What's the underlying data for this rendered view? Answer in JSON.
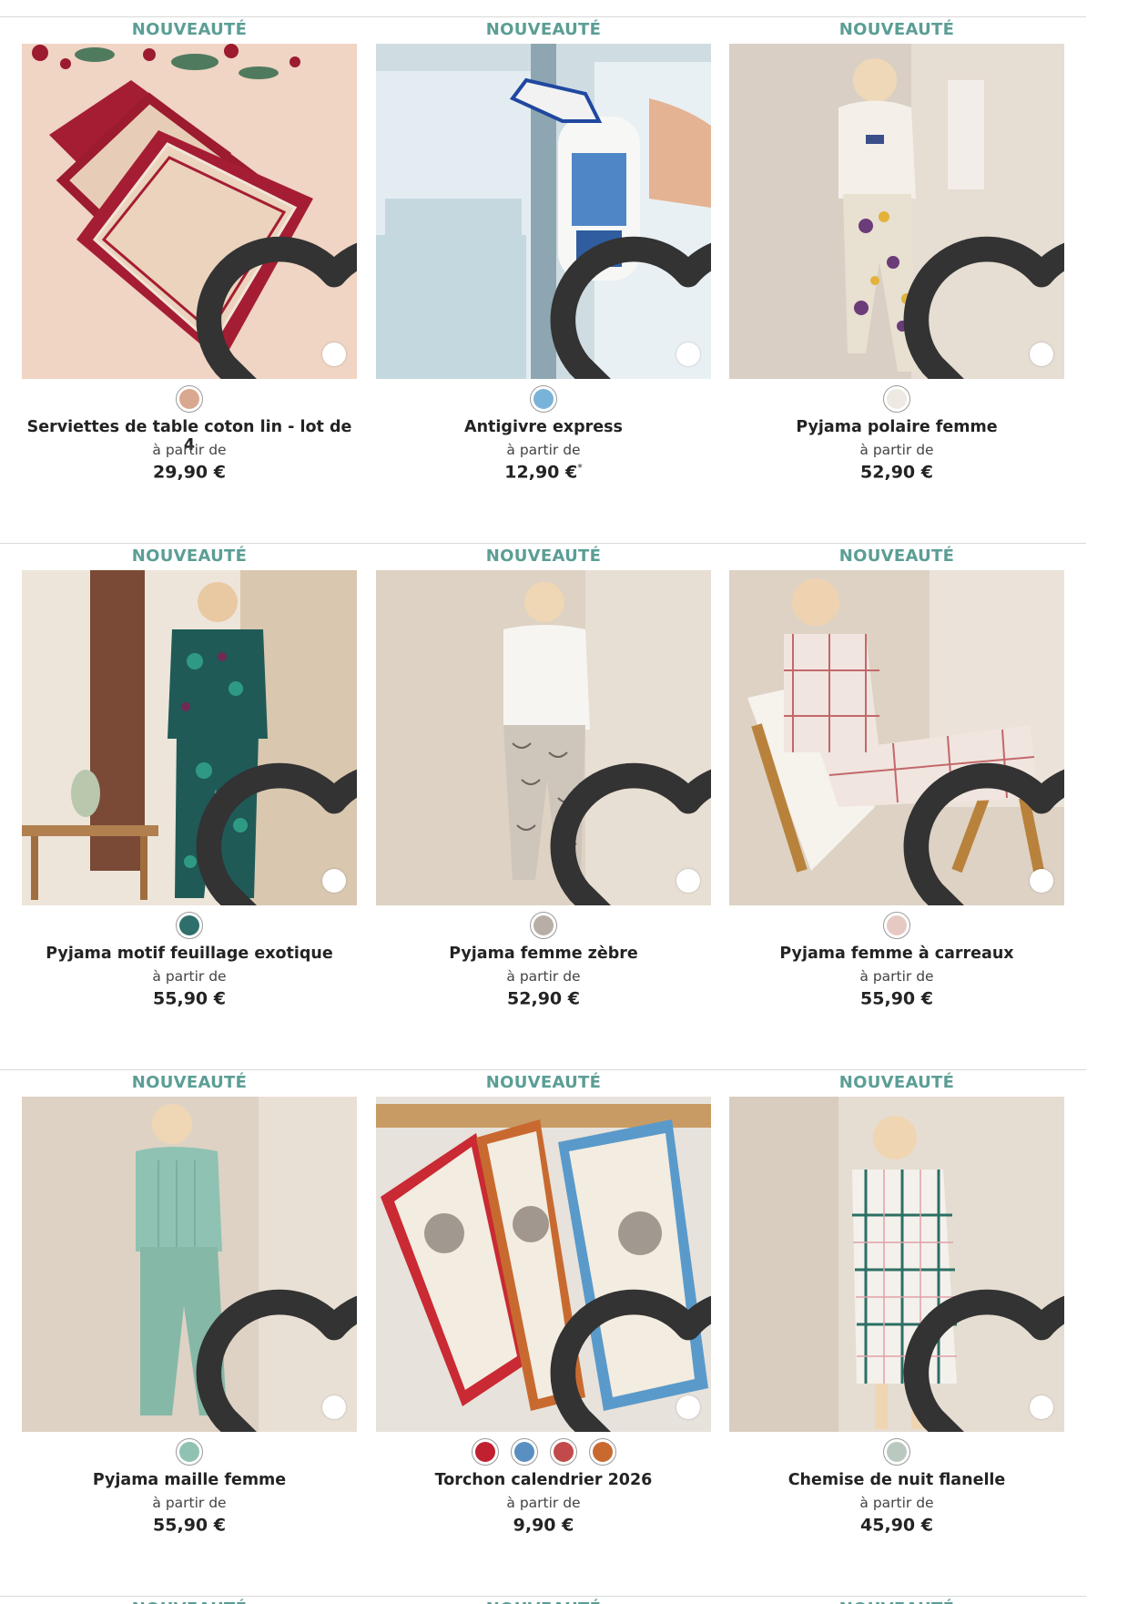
{
  "badge_label": "NOUVEAUTÉ",
  "from_label": "à partir de",
  "products": [
    {
      "title": "Serviettes de table coton lin - lot de 4",
      "price": "29,90 €",
      "price_mark": "",
      "swatches": [
        "#d9a88e"
      ],
      "image": "napkins"
    },
    {
      "title": "Antigivre express",
      "price": "12,90 €",
      "price_mark": "*",
      "swatches": [
        "#7ab3d9"
      ],
      "image": "spray"
    },
    {
      "title": "Pyjama polaire femme",
      "price": "52,90 €",
      "price_mark": "",
      "swatches": [
        "#efe9e3"
      ],
      "image": "pyjama-fleece"
    },
    {
      "title": "Pyjama motif feuillage exotique",
      "price": "55,90 €",
      "price_mark": "",
      "swatches": [
        "#2f6f6b"
      ],
      "image": "pyjama-leaf"
    },
    {
      "title": "Pyjama femme zèbre",
      "price": "52,90 €",
      "price_mark": "",
      "swatches": [
        "#b7aea6"
      ],
      "image": "pyjama-zebra"
    },
    {
      "title": "Pyjama femme à carreaux",
      "price": "55,90 €",
      "price_mark": "",
      "swatches": [
        "#e7c9c4"
      ],
      "image": "pyjama-check"
    },
    {
      "title": "Pyjama maille femme",
      "price": "55,90 €",
      "price_mark": "",
      "swatches": [
        "#8fc2b2"
      ],
      "image": "pyjama-knit"
    },
    {
      "title": "Torchon calendrier 2026",
      "price": "9,90 €",
      "price_mark": "",
      "swatches": [
        "#c0202f",
        "#5a8fc2",
        "#c34a4a",
        "#c86a30"
      ],
      "image": "tea-towels"
    },
    {
      "title": "Chemise de nuit flanelle",
      "price": "45,90 €",
      "price_mark": "",
      "swatches": [
        "#b9c9bf"
      ],
      "image": "nightshirt"
    }
  ],
  "next_row_badges": [
    "NOUVEAUTÉ",
    "NOUVEAUTÉ",
    "NOUVEAUTÉ"
  ],
  "icons": {
    "favorite": "heart-icon"
  }
}
